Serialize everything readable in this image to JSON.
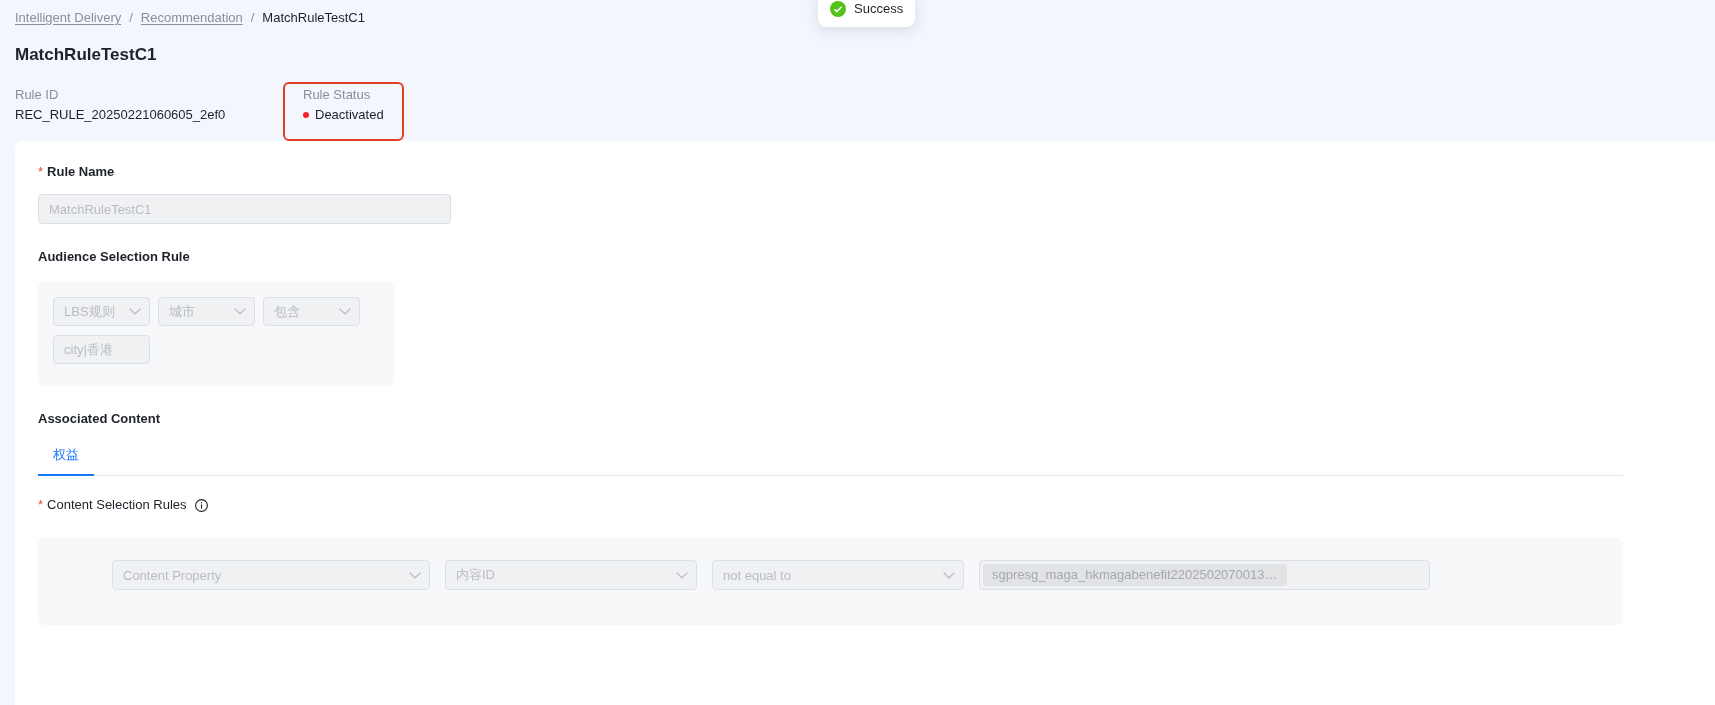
{
  "toast": {
    "kind": "success",
    "text": "Success"
  },
  "breadcrumb": [
    {
      "label": "Intelligent Delivery",
      "link": true,
      "separator": "/"
    },
    {
      "label": "Recommendation",
      "link": true,
      "separator": "/"
    },
    {
      "label": "MatchRuleTestC1",
      "link": false
    }
  ],
  "title": "MatchRuleTestC1",
  "info": [
    {
      "kind": "text",
      "label": "Rule ID",
      "value": "REC_RULE_20250221060605_2ef0"
    },
    {
      "kind": "status",
      "label": "Rule Status",
      "value": "Deactivated",
      "color": "#f5222d",
      "highlighted": true
    }
  ],
  "form": {
    "rule_name": {
      "label": "Rule Name",
      "required_mark": "*",
      "value": "MatchRuleTestC1",
      "disabled": true
    },
    "audience_rule": {
      "label": "Audience Selection Rule",
      "conditions": [
        {
          "kind": "select",
          "value": "LBS规则",
          "disabled": true
        },
        {
          "kind": "select",
          "value": "城市",
          "disabled": true
        },
        {
          "kind": "select",
          "value": "包含",
          "disabled": true
        },
        {
          "kind": "input",
          "value": "city|香港",
          "disabled": true
        }
      ]
    },
    "associated_content": {
      "label": "Associated Content",
      "tabs": [
        {
          "label": "权益",
          "selected": true
        }
      ],
      "content_rules": {
        "label": "Content Selection Rules",
        "required_mark": "*",
        "help_icon": true,
        "conditions": [
          {
            "kind": "select",
            "value": "Content Property",
            "disabled": true
          },
          {
            "kind": "select",
            "value": "内容ID",
            "disabled": true
          },
          {
            "kind": "select",
            "value": "not equal to",
            "disabled": true
          },
          {
            "kind": "tags",
            "tags": [
              "sgpresg_maga_hkmagabenefit2202502070013…"
            ],
            "disabled": true
          }
        ]
      }
    }
  }
}
